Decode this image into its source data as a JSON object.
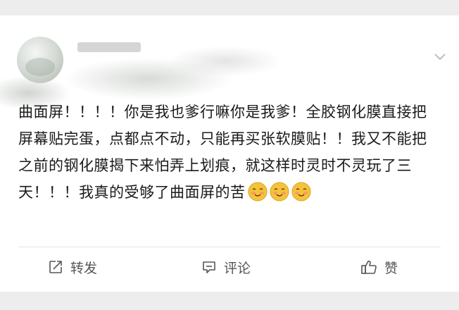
{
  "post": {
    "text": "曲面屏！！！！你是我也爹行嘛你是我爹！全胶钢化膜直接把屏幕贴完蛋，点都点不动，只能再买张软膜贴！！我又不能把之前的钢化膜揭下来怕弄上划痕，就这样时灵时不灵玩了三天！！！我真的受够了曲面屏的苦",
    "emojis": [
      "smile-emoji",
      "smile-emoji",
      "smile-emoji"
    ]
  },
  "header": {
    "menu_icon": "chevron-down-icon"
  },
  "actions": {
    "repost": {
      "label": "转发",
      "icon": "share-icon"
    },
    "comment": {
      "label": "评论",
      "icon": "comment-icon"
    },
    "like": {
      "label": "赞",
      "icon": "thumbs-up-icon"
    }
  },
  "colors": {
    "background": "#ededed",
    "card": "#ffffff",
    "text": "#1a1a1a",
    "action_text": "#555555",
    "emoji_face": "#f5c33b"
  }
}
